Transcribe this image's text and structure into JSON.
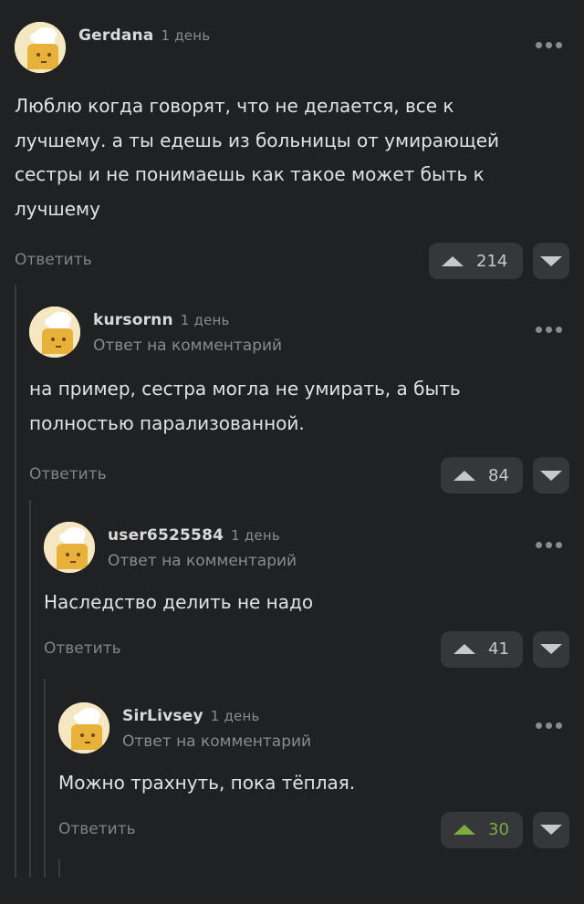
{
  "comments": [
    {
      "username": "Gerdana",
      "time": "1 день",
      "reply_to": "",
      "text": "Люблю когда говорят, что не делается, все к лучшему. а ты едешь из больницы от умирающей сестры и не понимаешь как такое может быть к лучшему",
      "reply_label": "Ответить",
      "rating": "214"
    },
    {
      "username": "kursornn",
      "time": "1 день",
      "reply_to": "Ответ на комментарий",
      "text": "на пример, сестра могла не умирать, а быть полностью парализованной.",
      "reply_label": "Ответить",
      "rating": "84"
    },
    {
      "username": "user6525584",
      "time": "1 день",
      "reply_to": "Ответ на комментарий",
      "text": "Наследство делить не надо",
      "reply_label": "Ответить",
      "rating": "41"
    },
    {
      "username": "SirLivsey",
      "time": "1 день",
      "reply_to": "Ответ на комментарий",
      "text": "Можно трахнуть, пока тёплая.",
      "reply_label": "Ответить",
      "rating": "30"
    }
  ],
  "icons": {
    "upvote": "triangle-up-icon",
    "downvote": "triangle-down-icon",
    "more": "more-dots-icon",
    "avatar": "default-chef-avatar-icon"
  },
  "colors": {
    "background": "#202123",
    "button_bg": "#36373a",
    "muted_text": "#8a8b8e",
    "positive_vote": "#7dab3c"
  }
}
